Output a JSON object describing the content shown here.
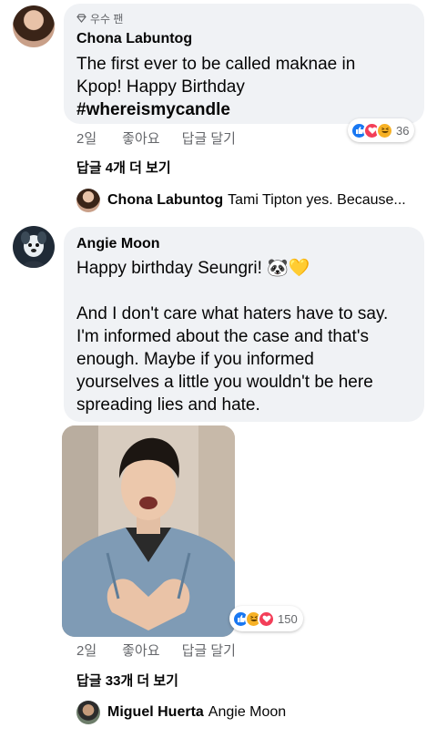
{
  "comments": [
    {
      "badge": "우수 팬",
      "author": "Chona Labuntog",
      "text_lines": [
        "The first ever to be called maknae in",
        "Kpop! Happy Birthday"
      ],
      "hashtag": "#whereismycandle",
      "time": "2일",
      "like": "좋아요",
      "reply": "답글 달기",
      "reaction_count": "36",
      "reactions": [
        "like",
        "love",
        "haha"
      ],
      "more_replies": "답글 4개 더 보기",
      "reply_preview": {
        "name": "Chona Labuntog",
        "text": "Tami Tipton yes. Because..."
      }
    },
    {
      "author": "Angie Moon",
      "text_lines": [
        "Happy birthday Seungri!",
        "",
        "And I don't care what haters have to say.",
        "I'm informed about the case and that's",
        "enough. Maybe if you informed",
        "yourselves a little you wouldn't be here",
        "spreading lies and hate."
      ],
      "emoji": "🐼💛",
      "time": "2일",
      "like": "좋아요",
      "reply": "답글 달기",
      "reaction_count": "150",
      "reactions": [
        "like",
        "haha",
        "love"
      ],
      "more_replies": "답글 33개 더 보기",
      "reply_preview": {
        "name": "Miguel Huerta",
        "text": "Angie Moon"
      }
    }
  ],
  "colors": {
    "bubble": "#f0f2f5",
    "like": "#1877f2",
    "love": "#f33e58",
    "haha": "#f7b125",
    "muted": "#65676b"
  }
}
